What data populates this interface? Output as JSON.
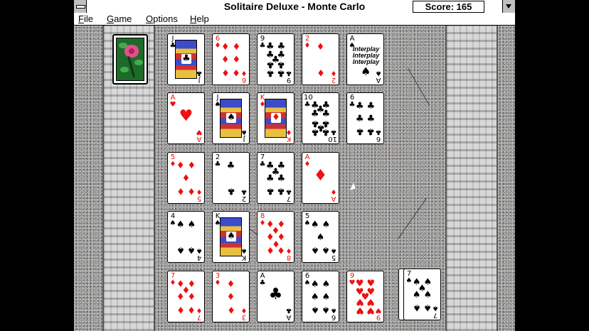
{
  "window": {
    "title": "Solitaire Deluxe - Monte Carlo",
    "score_text": "Score: 165"
  },
  "menu": [
    "File",
    "Game",
    "Options",
    "Help"
  ],
  "colors": {
    "red_suit": "#e11",
    "black_suit": "#000",
    "felt": "#a2a2a2"
  },
  "grid": [
    [
      {
        "rank": "J",
        "suit": "♣",
        "color": "black",
        "face": true
      },
      {
        "rank": "6",
        "suit": "♦",
        "color": "red"
      },
      {
        "rank": "9",
        "suit": "♣",
        "color": "black"
      },
      {
        "rank": "2",
        "suit": "♦",
        "color": "red"
      },
      {
        "rank": "A",
        "suit": "♠",
        "color": "black",
        "interplay": true
      }
    ],
    [
      {
        "rank": "A",
        "suit": "♥",
        "color": "red"
      },
      {
        "rank": "J",
        "suit": "♠",
        "color": "black",
        "face": true
      },
      {
        "rank": "K",
        "suit": "♦",
        "color": "red",
        "face": true
      },
      {
        "rank": "10",
        "suit": "♣",
        "color": "black"
      },
      {
        "rank": "6",
        "suit": "♣",
        "color": "black"
      }
    ],
    [
      {
        "rank": "5",
        "suit": "♦",
        "color": "red"
      },
      {
        "rank": "2",
        "suit": "♣",
        "color": "black"
      },
      {
        "rank": "7",
        "suit": "♣",
        "color": "black"
      },
      {
        "rank": "A",
        "suit": "♦",
        "color": "red"
      }
    ],
    [
      {
        "rank": "4",
        "suit": "♠",
        "color": "black"
      },
      {
        "rank": "K",
        "suit": "♠",
        "color": "black",
        "face": true
      },
      {
        "rank": "8",
        "suit": "♦",
        "color": "red"
      },
      {
        "rank": "5",
        "suit": "♠",
        "color": "black"
      }
    ],
    [
      {
        "rank": "7",
        "suit": "♦",
        "color": "red"
      },
      {
        "rank": "3",
        "suit": "♦",
        "color": "red"
      },
      {
        "rank": "A",
        "suit": "♣",
        "color": "black"
      },
      {
        "rank": "6",
        "suit": "♠",
        "color": "black"
      },
      {
        "rank": "9",
        "suit": "♥",
        "color": "red"
      }
    ]
  ],
  "interplay_text": [
    "Interplay",
    "Interplay",
    "Interplay"
  ],
  "waste": {
    "rank": "7",
    "suit": "♠",
    "color": "black"
  },
  "stock": {
    "icon": "rose-card-back-icon"
  }
}
